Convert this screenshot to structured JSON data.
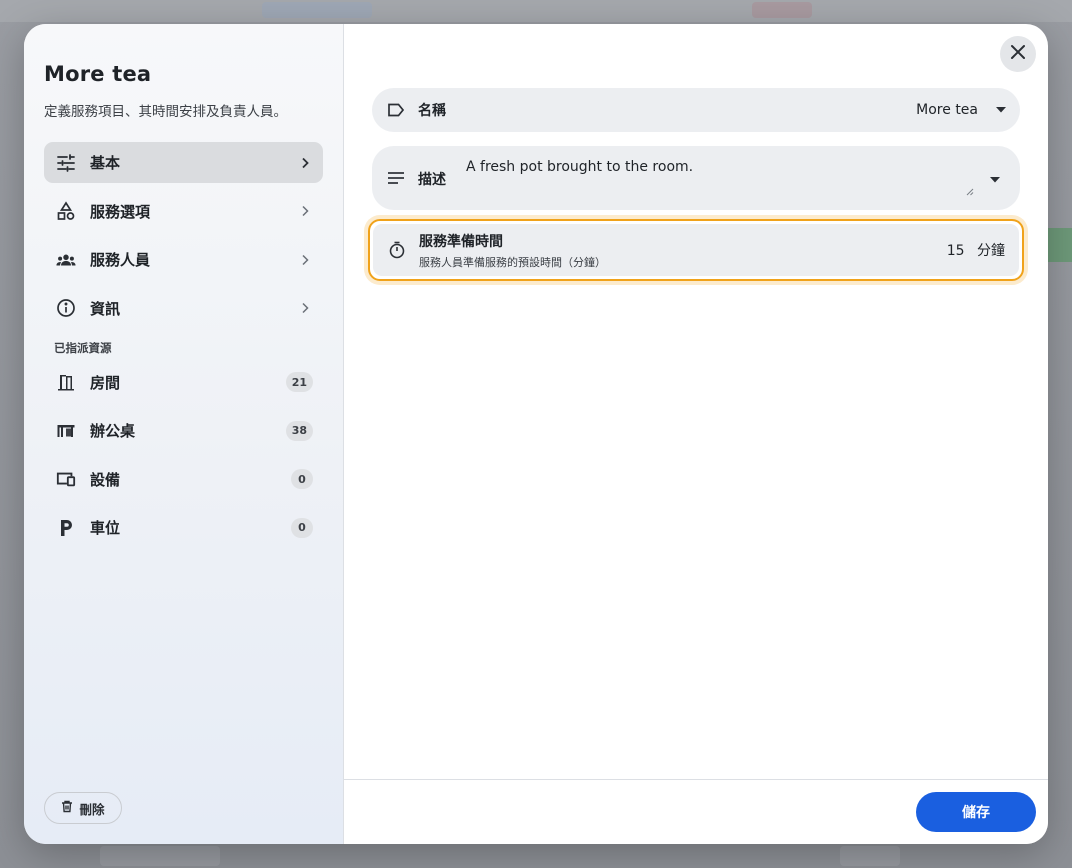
{
  "sidebar": {
    "title": "More tea",
    "subtitle": "定義服務項目、其時間安排及負責人員。",
    "nav": [
      {
        "label": "基本",
        "icon": "tune-icon",
        "active": true
      },
      {
        "label": "服務選項",
        "icon": "shapes-icon",
        "active": false
      },
      {
        "label": "服務人員",
        "icon": "group-icon",
        "active": false
      },
      {
        "label": "資訊",
        "icon": "info-icon",
        "active": false
      }
    ],
    "resources_label": "已指派資源",
    "resources": [
      {
        "label": "房間",
        "icon": "door-icon",
        "count": "21"
      },
      {
        "label": "辦公桌",
        "icon": "desk-icon",
        "count": "38"
      },
      {
        "label": "設備",
        "icon": "devices-icon",
        "count": "0"
      },
      {
        "label": "車位",
        "icon": "parking-icon",
        "count": "0"
      }
    ],
    "delete_label": "刪除"
  },
  "form": {
    "name": {
      "label": "名稱",
      "value": "More tea",
      "icon": "label-icon"
    },
    "description": {
      "label": "描述",
      "value": "A fresh pot brought to the room.",
      "icon": "notes-icon"
    },
    "prep_time": {
      "label": "服務準備時間",
      "sublabel": "服務人員準備服務的預設時間（分鐘）",
      "value": "15",
      "unit": "分鐘",
      "icon": "timer-icon",
      "highlight_color": "#f0a21a"
    }
  },
  "footer": {
    "save_label": "儲存"
  },
  "colors": {
    "primary": "#1a5fe0",
    "highlight": "#f0a21a"
  }
}
